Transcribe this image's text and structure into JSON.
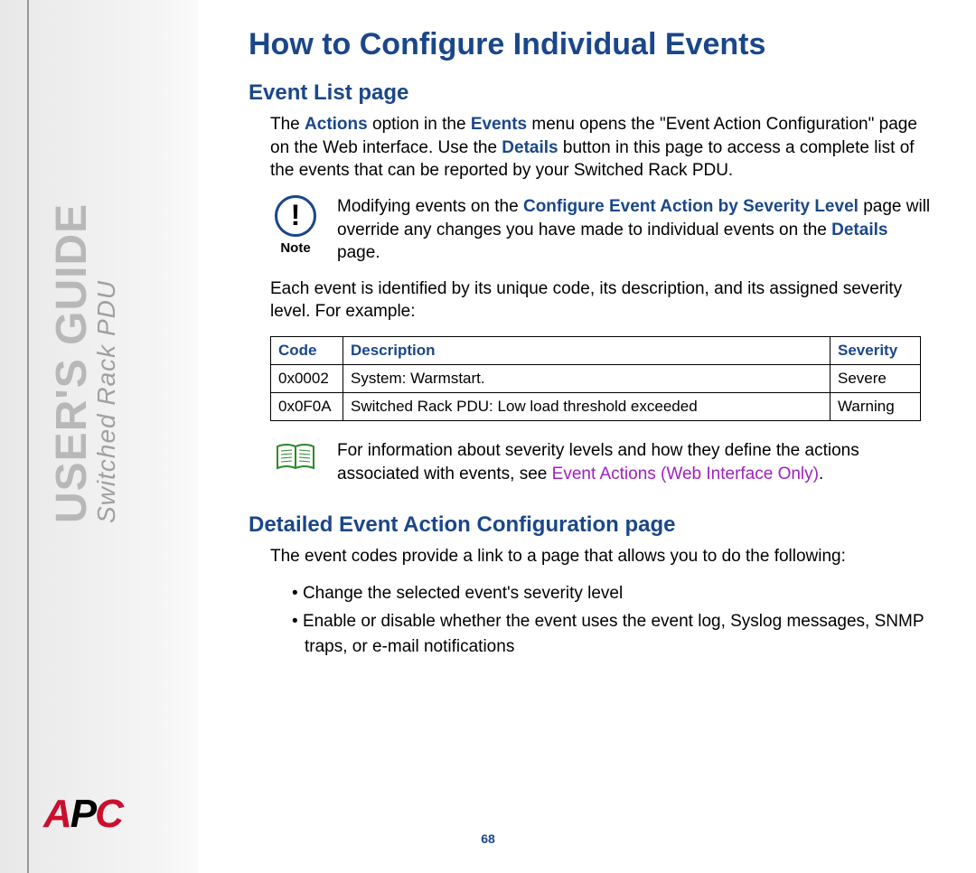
{
  "sidebar": {
    "title": "USER'S GUIDE",
    "subtitle": "Switched Rack PDU"
  },
  "logo": {
    "a": "A",
    "p": "P",
    "c": "C"
  },
  "page": {
    "title": "How to Configure Individual Events",
    "number": "68"
  },
  "section1": {
    "heading": "Event List page",
    "para1_a": "The ",
    "para1_b": "Actions",
    "para1_c": " option in the ",
    "para1_d": "Events",
    "para1_e": " menu opens the \"Event Action Configuration\" page on the Web interface. Use the ",
    "para1_f": "Details",
    "para1_g": " button in this page to access a complete list of the events that can be reported by your Switched Rack PDU.",
    "note_label": "Note",
    "note_a": "Modifying events on the ",
    "note_b": "Configure Event Action by Severity Level",
    "note_c": " page will override any changes you have made to individual events on the ",
    "note_d": "Details",
    "note_e": " page.",
    "para2": "Each event is identified by its unique code, its description, and its assigned severity level. For example:",
    "table": {
      "headers": {
        "code": "Code",
        "desc": "Description",
        "sev": "Severity"
      },
      "rows": [
        {
          "code": "0x0002",
          "desc": "System: Warmstart.",
          "sev": "Severe"
        },
        {
          "code": "0x0F0A",
          "desc": "Switched Rack PDU: Low load threshold exceeded",
          "sev": "Warning"
        }
      ]
    },
    "ref_a": "For information about severity levels and how they define the actions associated with events, see ",
    "ref_link": "Event Actions (Web Interface Only)",
    "ref_b": "."
  },
  "section2": {
    "heading": "Detailed Event Action Configuration page",
    "para1": "The event codes provide a link to a page that allows you to do the following:",
    "bullets": [
      "Change the selected event's severity level",
      "Enable or disable whether the event uses the event log, Syslog messages, SNMP traps, or e-mail notifications"
    ]
  }
}
